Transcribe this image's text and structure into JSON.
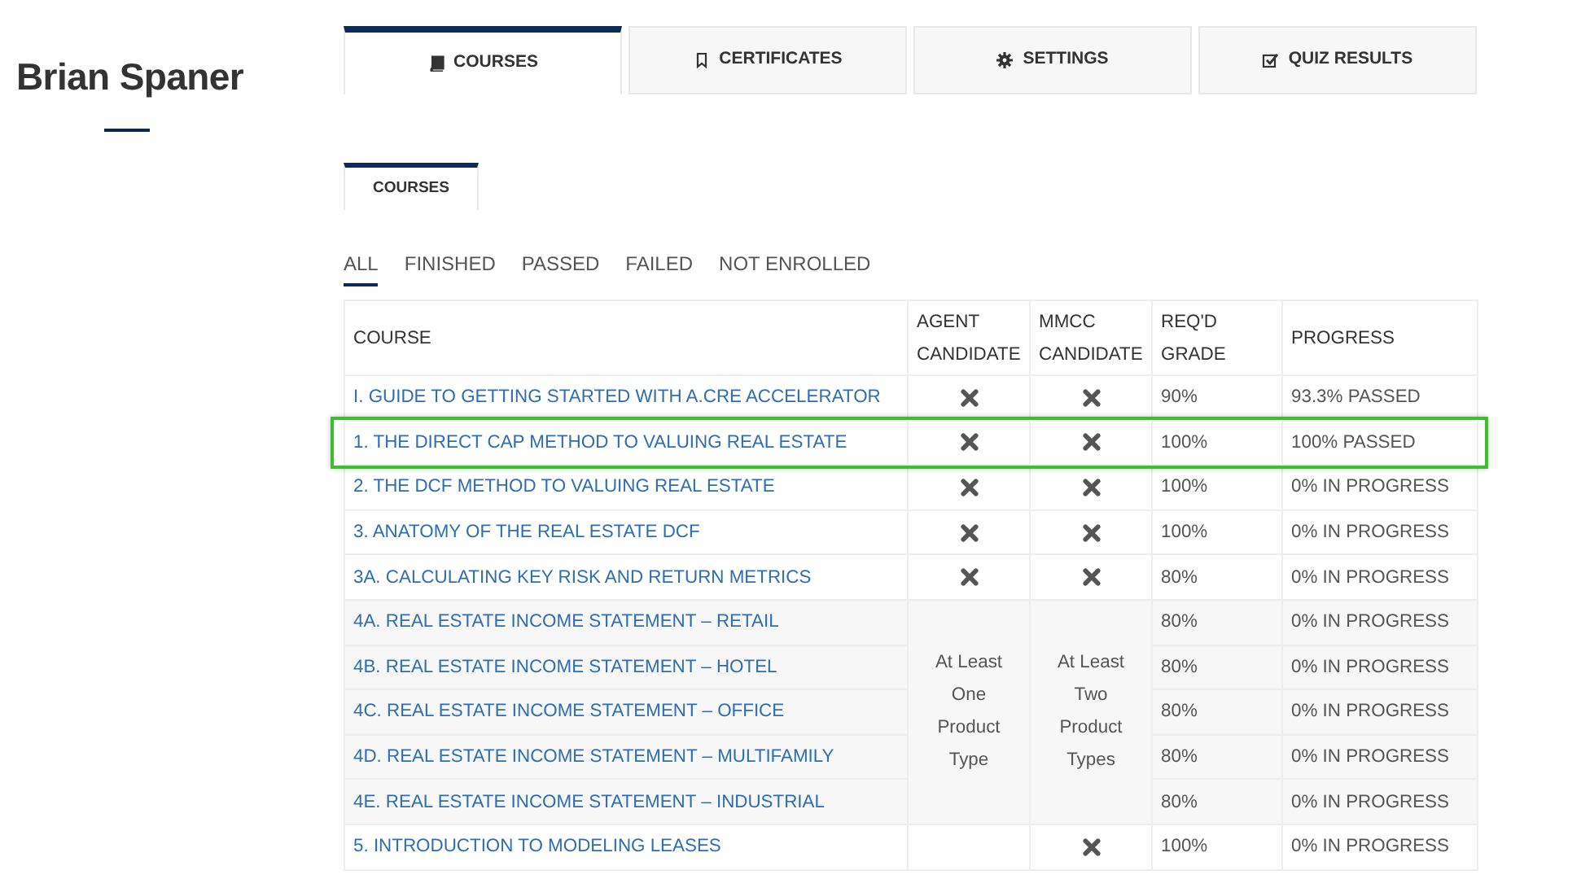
{
  "profile": {
    "name": "Brian Spaner"
  },
  "tabs": [
    {
      "label": "COURSES",
      "selected": true
    },
    {
      "label": "CERTIFICATES",
      "selected": false
    },
    {
      "label": "SETTINGS",
      "selected": false
    },
    {
      "label": "QUIZ RESULTS",
      "selected": false
    }
  ],
  "subtabs": [
    {
      "label": "COURSES",
      "selected": true
    }
  ],
  "filters": [
    {
      "label": "ALL",
      "selected": true
    },
    {
      "label": "FINISHED",
      "selected": false
    },
    {
      "label": "PASSED",
      "selected": false
    },
    {
      "label": "FAILED",
      "selected": false
    },
    {
      "label": "NOT ENROLLED",
      "selected": false
    }
  ],
  "table": {
    "columns": [
      "COURSE",
      "AGENT CANDIDATE",
      "MMCC CANDIDATE",
      "REQ'D GRADE",
      "PROGRESS"
    ],
    "rows": [
      {
        "course": "I. GUIDE TO GETTING STARTED WITH A.CRE ACCELERATOR",
        "agent": {
          "kind": "cross"
        },
        "mmcc": {
          "kind": "cross"
        },
        "grade": "90%",
        "progress": "93.3% PASSED",
        "highlighted": false
      },
      {
        "course": "1. THE DIRECT CAP METHOD TO VALUING REAL ESTATE",
        "agent": {
          "kind": "cross"
        },
        "mmcc": {
          "kind": "cross"
        },
        "grade": "100%",
        "progress": "100% PASSED",
        "highlighted": true
      },
      {
        "course": "2. THE DCF METHOD TO VALUING REAL ESTATE",
        "agent": {
          "kind": "cross"
        },
        "mmcc": {
          "kind": "cross"
        },
        "grade": "100%",
        "progress": "0% IN PROGRESS",
        "highlighted": false
      },
      {
        "course": "3. ANATOMY OF THE REAL ESTATE DCF",
        "agent": {
          "kind": "cross"
        },
        "mmcc": {
          "kind": "cross"
        },
        "grade": "100%",
        "progress": "0% IN PROGRESS",
        "highlighted": false
      },
      {
        "course": "3A. CALCULATING KEY RISK AND RETURN METRICS",
        "agent": {
          "kind": "cross"
        },
        "mmcc": {
          "kind": "cross"
        },
        "grade": "80%",
        "progress": "0% IN PROGRESS",
        "highlighted": false
      },
      {
        "course": "4A. REAL ESTATE INCOME STATEMENT – RETAIL",
        "agent": {
          "kind": "text",
          "text": "At Least One Product Type"
        },
        "mmcc": {
          "kind": "text",
          "text": "At Least Two Product Types"
        },
        "grade": "80%",
        "progress": "0% IN PROGRESS",
        "highlighted": false
      },
      {
        "course": "4B. REAL ESTATE INCOME STATEMENT – HOTEL",
        "grade": "80%",
        "progress": "0% IN PROGRESS",
        "highlighted": false
      },
      {
        "course": "4C. REAL ESTATE INCOME STATEMENT – OFFICE",
        "grade": "80%",
        "progress": "0% IN PROGRESS",
        "highlighted": false
      },
      {
        "course": "4D. REAL ESTATE INCOME STATEMENT – MULTIFAMILY",
        "grade": "80%",
        "progress": "0% IN PROGRESS",
        "highlighted": false
      },
      {
        "course": "4E. REAL ESTATE INCOME STATEMENT – INDUSTRIAL",
        "grade": "80%",
        "progress": "0% IN PROGRESS",
        "highlighted": false
      },
      {
        "course": "5. INTRODUCTION TO MODELING LEASES",
        "agent": {
          "kind": "blank"
        },
        "mmcc": {
          "kind": "cross"
        },
        "grade": "100%",
        "progress": "0% IN PROGRESS",
        "highlighted": false
      }
    ]
  }
}
